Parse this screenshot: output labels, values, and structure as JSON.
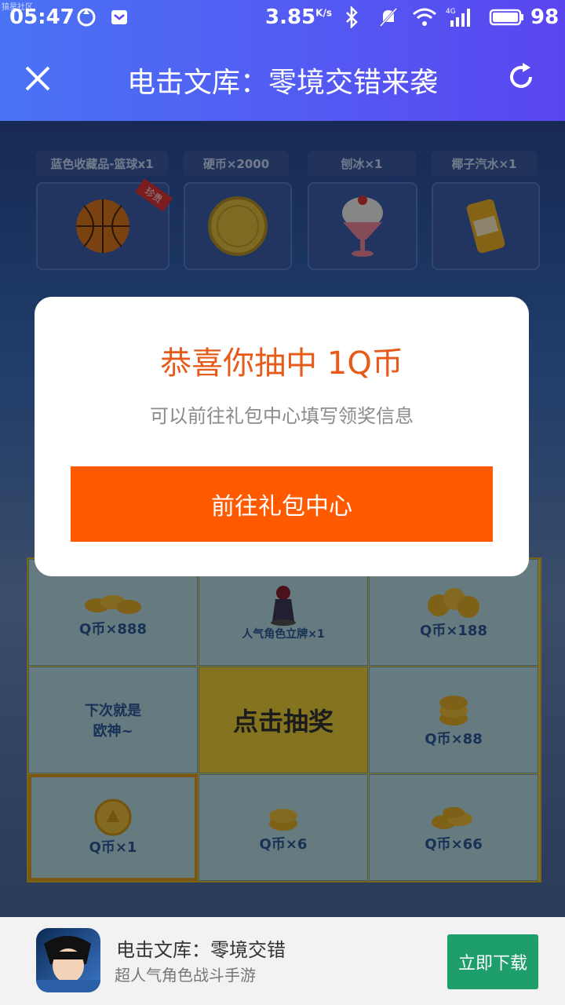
{
  "status_bar": {
    "overlay_text": "猿星社区",
    "time": "05:47",
    "speed": "3.85",
    "speed_unit": "K/s",
    "battery": "98",
    "network_label": "4G"
  },
  "header": {
    "title": "电击文库：零境交错来袭"
  },
  "prizes": [
    {
      "label": "蓝色收藏品-篮球x1",
      "icon": "basketball-icon",
      "tag": "珍贵"
    },
    {
      "label": "硬币×2000",
      "icon": "gold-coin-icon"
    },
    {
      "label": "刨冰×1",
      "icon": "shaved-ice-icon"
    },
    {
      "label": "椰子汽水×1",
      "icon": "soda-can-icon"
    }
  ],
  "lottery_grid": {
    "cells": [
      {
        "label": "Q币×888",
        "icon": "coins-icon"
      },
      {
        "label": "人气角色立牌×1",
        "icon": "character-stand-icon"
      },
      {
        "label": "Q币×188",
        "icon": "coins-icon"
      },
      {
        "label": "下次就是\n欧神~",
        "icon": ""
      },
      {
        "label": "点击抽奖",
        "icon": ""
      },
      {
        "label": "Q币×88",
        "icon": "coins-icon"
      },
      {
        "label": "Q币×1",
        "icon": "coin-icon"
      },
      {
        "label": "Q币×6",
        "icon": "coins-icon"
      },
      {
        "label": "Q币×66",
        "icon": "coins-icon"
      }
    ],
    "selected_index": 6
  },
  "dialog": {
    "title": "恭喜你抽中 1Q币",
    "subtitle": "可以前往礼包中心填写领奖信息",
    "button": "前往礼包中心"
  },
  "bottom_banner": {
    "app_name": "电击文库：零境交错",
    "description": "超人气角色战斗手游",
    "download_button": "立即下载"
  },
  "colors": {
    "header_gradient_start": "#4a73f5",
    "header_gradient_end": "#5a46f0",
    "dialog_title": "#e65b1a",
    "dialog_button": "#ff5a00",
    "download_button": "#1e9e6a",
    "grid_frame": "#f0d43a"
  }
}
